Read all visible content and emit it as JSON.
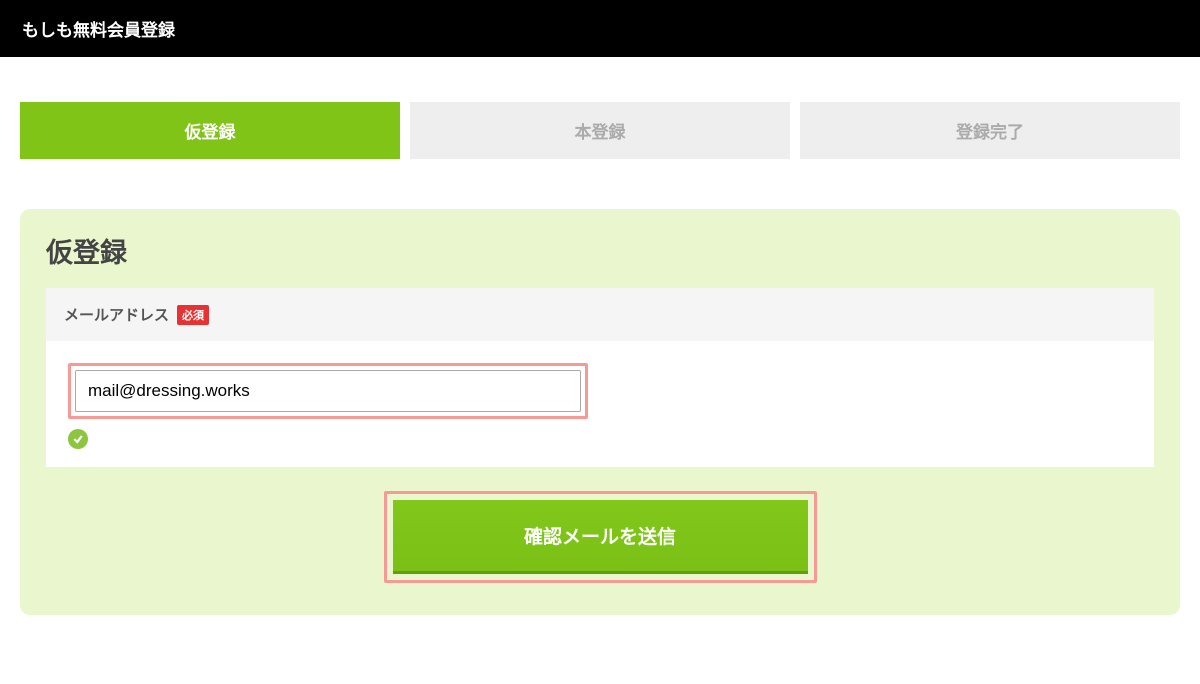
{
  "header": {
    "title": "もしも無料会員登録"
  },
  "tabs": {
    "items": [
      {
        "label": "仮登録",
        "active": true
      },
      {
        "label": "本登録",
        "active": false
      },
      {
        "label": "登録完了",
        "active": false
      }
    ]
  },
  "panel": {
    "title": "仮登録",
    "field": {
      "label": "メールアドレス",
      "required_badge": "必須",
      "value": "mail@dressing.works"
    },
    "submit_label": "確認メールを送信"
  }
}
